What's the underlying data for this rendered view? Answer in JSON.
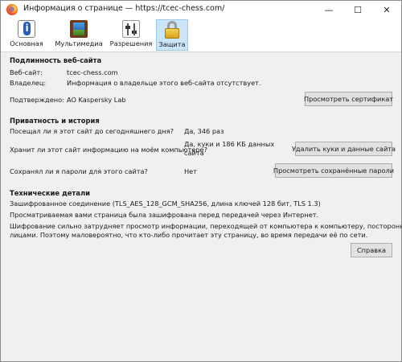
{
  "window": {
    "title": "Информация о странице — https://tcec-chess.com/",
    "minimize": "—",
    "maximize": "☐",
    "close": "✕"
  },
  "tabs": [
    {
      "label": "Основная",
      "icon": "info-icon"
    },
    {
      "label": "Мультимедиа",
      "icon": "media-icon"
    },
    {
      "label": "Разрешения",
      "icon": "permissions-icon"
    },
    {
      "label": "Защита",
      "icon": "lock-icon",
      "active": true
    }
  ],
  "identity": {
    "title": "Подлинность веб-сайта",
    "website_label": "Веб-сайт:",
    "website_value": "tcec-chess.com",
    "owner_label": "Владелец:",
    "owner_value": "Информация о владельце этого веб-сайта отсутствует.",
    "verified_label": "Подтверждено:",
    "verified_value": "AO Kaspersky Lab",
    "view_cert_button": "Просмотреть сертификат"
  },
  "privacy": {
    "title": "Приватность и история",
    "visited_q": "Посещал ли я этот сайт до сегодняшнего дня?",
    "visited_a": "Да, 346 раз",
    "stored_q": "Хранит ли этот сайт информацию на моём компьютере?",
    "stored_a_line1": "Да, куки и 186 КБ данных",
    "stored_a_line2": "сайта",
    "clear_button": "Удалить куки и данные сайта",
    "passwords_q": "Сохранял ли я пароли для этого сайта?",
    "passwords_a": "Нет",
    "passwords_button": "Просмотреть сохранённые пароли"
  },
  "technical": {
    "title": "Технические детали",
    "line1": "Зашифрованное соединение (TLS_AES_128_GCM_SHA256, длина ключей 128 бит, TLS 1.3)",
    "line2": "Просматриваемая вами страница была зашифрована перед передачей через Интернет.",
    "line3": "Шифрование сильно затрудняет просмотр информации, переходящей от компьютера к компьютеру, посторонними",
    "line4": "лицами. Поэтому маловероятно, что кто-либо прочитает эту страницу, во время передачи её по сети.",
    "help_button": "Справка"
  }
}
